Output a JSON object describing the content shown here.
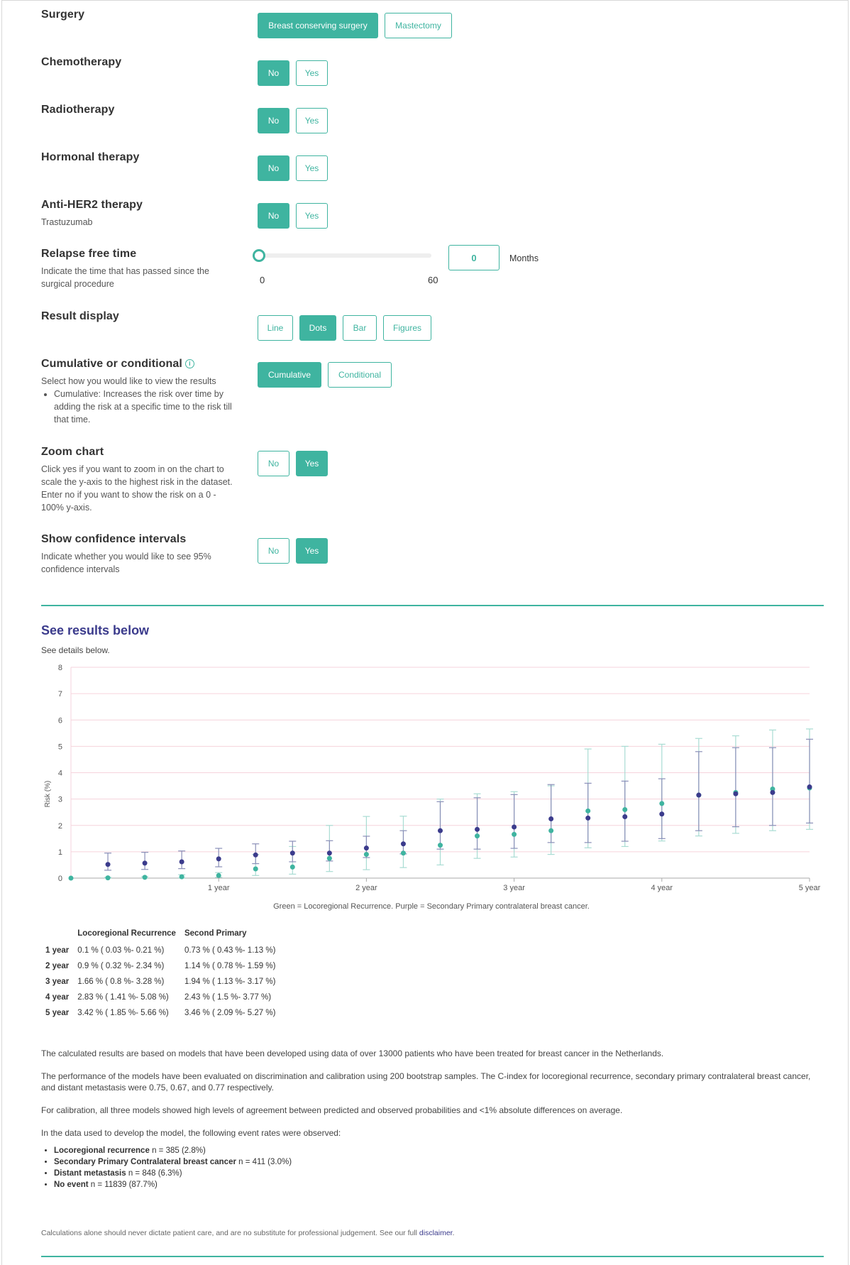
{
  "surgery": {
    "title": "Surgery",
    "options": [
      "Breast conserving surgery",
      "Mastectomy"
    ],
    "selected": "Breast conserving surgery"
  },
  "chemotherapy": {
    "title": "Chemotherapy",
    "options": [
      "No",
      "Yes"
    ],
    "selected": "No"
  },
  "radiotherapy": {
    "title": "Radiotherapy",
    "options": [
      "No",
      "Yes"
    ],
    "selected": "No"
  },
  "hormonal": {
    "title": "Hormonal therapy",
    "options": [
      "No",
      "Yes"
    ],
    "selected": "No"
  },
  "her2": {
    "title": "Anti-HER2 therapy",
    "subtitle": "Trastuzumab",
    "options": [
      "No",
      "Yes"
    ],
    "selected": "No"
  },
  "relapse": {
    "title": "Relapse free time",
    "description": "Indicate the time that has passed since the surgical procedure",
    "min": "0",
    "max": "60",
    "value": "0",
    "unit": "Months"
  },
  "display": {
    "title": "Result display",
    "options": [
      "Line",
      "Dots",
      "Bar",
      "Figures"
    ],
    "selected": "Dots"
  },
  "cumulative": {
    "title": "Cumulative or conditional",
    "description": "Select how you would like to view the results",
    "bullet": "Cumulative: Increases the risk over time by adding the risk at a specific time to the risk till that time.",
    "options": [
      "Cumulative",
      "Conditional"
    ],
    "selected": "Cumulative"
  },
  "zoom": {
    "title": "Zoom chart",
    "description": "Click yes if you want to zoom in on the chart to scale the y-axis to the highest risk in the dataset. Enter no if you want to show the risk on a 0 - 100% y-axis.",
    "options": [
      "No",
      "Yes"
    ],
    "selected": "Yes"
  },
  "ci": {
    "title": "Show confidence intervals",
    "description": "Indicate whether you would like to see 95% confidence intervals",
    "options": [
      "No",
      "Yes"
    ],
    "selected": "Yes"
  },
  "results": {
    "title": "See results below",
    "subtitle": "See details below."
  },
  "chart_data": {
    "type": "scatter",
    "ylabel": "Risk (%)",
    "ylim": [
      0,
      8
    ],
    "yticks": [
      "0",
      "1",
      "2",
      "3",
      "4",
      "5",
      "6",
      "7",
      "8"
    ],
    "xlim": [
      0,
      60
    ],
    "xticks": [
      {
        "x": 12,
        "label": "1 year"
      },
      {
        "x": 24,
        "label": "2 year"
      },
      {
        "x": 36,
        "label": "3 year"
      },
      {
        "x": 48,
        "label": "4 year"
      },
      {
        "x": 60,
        "label": "5 year"
      }
    ],
    "caption": "Green = Locoregional Recurrence. Purple = Secondary Primary contralateral breast cancer.",
    "series": [
      {
        "color": "#3fb4a0",
        "ci_color": "#a9dcd3",
        "points": [
          {
            "x": 0,
            "y": 0,
            "lo": 0,
            "hi": 0
          },
          {
            "x": 3,
            "y": 0.01,
            "lo": 0,
            "hi": 0.03
          },
          {
            "x": 6,
            "y": 0.03,
            "lo": 0.01,
            "hi": 0.06
          },
          {
            "x": 9,
            "y": 0.05,
            "lo": 0.01,
            "hi": 0.13
          },
          {
            "x": 12,
            "y": 0.1,
            "lo": 0.03,
            "hi": 0.21
          },
          {
            "x": 15,
            "y": 0.35,
            "lo": 0.1,
            "hi": 0.9
          },
          {
            "x": 18,
            "y": 0.42,
            "lo": 0.15,
            "hi": 1.2
          },
          {
            "x": 21,
            "y": 0.75,
            "lo": 0.25,
            "hi": 2.0
          },
          {
            "x": 24,
            "y": 0.9,
            "lo": 0.32,
            "hi": 2.34
          },
          {
            "x": 27,
            "y": 0.95,
            "lo": 0.4,
            "hi": 2.35
          },
          {
            "x": 30,
            "y": 1.25,
            "lo": 0.5,
            "hi": 3.0
          },
          {
            "x": 33,
            "y": 1.6,
            "lo": 0.75,
            "hi": 3.2
          },
          {
            "x": 36,
            "y": 1.66,
            "lo": 0.8,
            "hi": 3.28
          },
          {
            "x": 39,
            "y": 1.8,
            "lo": 0.9,
            "hi": 3.5
          },
          {
            "x": 42,
            "y": 2.55,
            "lo": 1.15,
            "hi": 4.9
          },
          {
            "x": 45,
            "y": 2.6,
            "lo": 1.2,
            "hi": 5.0
          },
          {
            "x": 48,
            "y": 2.83,
            "lo": 1.41,
            "hi": 5.08
          },
          {
            "x": 51,
            "y": 3.15,
            "lo": 1.6,
            "hi": 5.3
          },
          {
            "x": 54,
            "y": 3.25,
            "lo": 1.7,
            "hi": 5.4
          },
          {
            "x": 57,
            "y": 3.38,
            "lo": 1.8,
            "hi": 5.62
          },
          {
            "x": 60,
            "y": 3.42,
            "lo": 1.85,
            "hi": 5.66
          }
        ]
      },
      {
        "color": "#3b3b8c",
        "ci_color": "#8a8fb8",
        "points": [
          {
            "x": 3,
            "y": 0.52,
            "lo": 0.3,
            "hi": 0.95
          },
          {
            "x": 6,
            "y": 0.57,
            "lo": 0.33,
            "hi": 0.98
          },
          {
            "x": 9,
            "y": 0.62,
            "lo": 0.36,
            "hi": 1.03
          },
          {
            "x": 12,
            "y": 0.73,
            "lo": 0.43,
            "hi": 1.13
          },
          {
            "x": 15,
            "y": 0.88,
            "lo": 0.55,
            "hi": 1.3
          },
          {
            "x": 18,
            "y": 0.95,
            "lo": 0.62,
            "hi": 1.4
          },
          {
            "x": 21,
            "y": 0.95,
            "lo": 0.65,
            "hi": 1.42
          },
          {
            "x": 24,
            "y": 1.14,
            "lo": 0.78,
            "hi": 1.59
          },
          {
            "x": 27,
            "y": 1.3,
            "lo": 0.92,
            "hi": 1.8
          },
          {
            "x": 30,
            "y": 1.8,
            "lo": 1.1,
            "hi": 2.9
          },
          {
            "x": 33,
            "y": 1.85,
            "lo": 1.1,
            "hi": 3.05
          },
          {
            "x": 36,
            "y": 1.94,
            "lo": 1.13,
            "hi": 3.17
          },
          {
            "x": 39,
            "y": 2.25,
            "lo": 1.35,
            "hi": 3.55
          },
          {
            "x": 42,
            "y": 2.28,
            "lo": 1.35,
            "hi": 3.6
          },
          {
            "x": 45,
            "y": 2.33,
            "lo": 1.4,
            "hi": 3.68
          },
          {
            "x": 48,
            "y": 2.43,
            "lo": 1.5,
            "hi": 3.77
          },
          {
            "x": 51,
            "y": 3.15,
            "lo": 1.8,
            "hi": 4.8
          },
          {
            "x": 54,
            "y": 3.2,
            "lo": 1.95,
            "hi": 4.95
          },
          {
            "x": 57,
            "y": 3.25,
            "lo": 2.0,
            "hi": 4.95
          },
          {
            "x": 60,
            "y": 3.46,
            "lo": 2.09,
            "hi": 5.27
          }
        ]
      }
    ]
  },
  "table": {
    "headers": [
      "",
      "Locoregional Recurrence",
      "Second Primary"
    ],
    "rows": [
      [
        "1 year",
        "0.1 % ( 0.03 %- 0.21 %)",
        "0.73 % ( 0.43 %- 1.13 %)"
      ],
      [
        "2 year",
        "0.9 % ( 0.32 %- 2.34 %)",
        "1.14 % ( 0.78 %- 1.59 %)"
      ],
      [
        "3 year",
        "1.66 % ( 0.8 %- 3.28 %)",
        "1.94 % ( 1.13 %- 3.17 %)"
      ],
      [
        "4 year",
        "2.83 % ( 1.41 %- 5.08 %)",
        "2.43 % ( 1.5 %- 3.77 %)"
      ],
      [
        "5 year",
        "3.42 % ( 1.85 %- 5.66 %)",
        "3.46 % ( 2.09 %- 5.27 %)"
      ]
    ]
  },
  "info": {
    "p1": "The calculated results are based on models that have been developed using data of over 13000 patients who have been treated for breast cancer in the Netherlands.",
    "p2": "The performance of the models have been evaluated on discrimination and calibration using 200 bootstrap samples. The C-index for locoregional recurrence, secondary primary contralateral breast cancer, and distant metastasis were 0.75, 0.67, and 0.77 respectively.",
    "p3": "For calibration, all three models showed high levels of agreement between predicted and observed probabilities and <1% absolute differences on average.",
    "p4": "In the data used to develop the model, the following event rates were observed:",
    "events": [
      {
        "label": "Locoregional recurrence",
        "value": "n = 385 (2.8%)"
      },
      {
        "label": "Secondary Primary Contralateral breast cancer",
        "value": "n = 411 (3.0%)"
      },
      {
        "label": "Distant metastasis",
        "value": "n = 848 (6.3%)"
      },
      {
        "label": "No event",
        "value": "n = 11839 (87.7%)"
      }
    ],
    "footnote": "Calculations alone should never dictate patient care, and are no substitute for professional judgement. See our full",
    "footnote_link": "disclaimer",
    "footnote_end": "."
  }
}
